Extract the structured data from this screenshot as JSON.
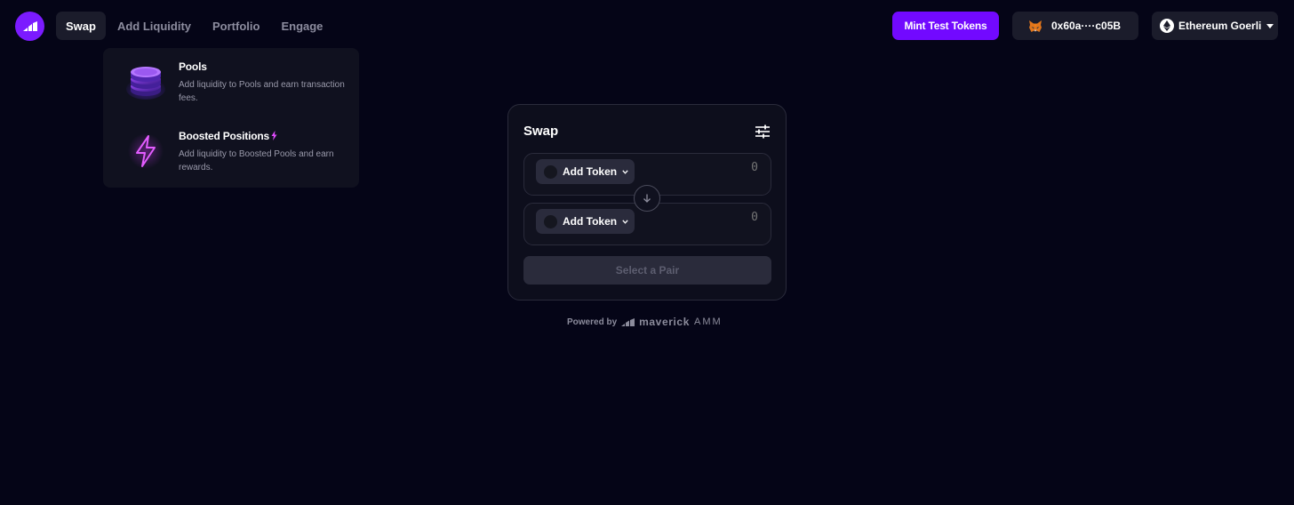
{
  "nav": {
    "items": [
      {
        "label": "Swap",
        "active": true
      },
      {
        "label": "Add Liquidity",
        "active": false
      },
      {
        "label": "Portfolio",
        "active": false
      },
      {
        "label": "Engage",
        "active": false
      }
    ]
  },
  "header": {
    "mint_label": "Mint Test Tokens",
    "wallet_address": "0x60a····c05B",
    "network_label": "Ethereum Goerli"
  },
  "dropdown": {
    "items": [
      {
        "title": "Pools",
        "description": "Add liquidity to Pools and earn transaction fees.",
        "icon": "pools-stack-icon"
      },
      {
        "title": "Boosted Positions",
        "description": "Add liquidity to Boosted Pools and earn rewards.",
        "icon": "lightning-bolt-icon"
      }
    ]
  },
  "swap": {
    "title": "Swap",
    "from": {
      "token_label": "Add Token",
      "amount": "0"
    },
    "to": {
      "token_label": "Add Token",
      "amount": "0"
    },
    "action_label": "Select a Pair"
  },
  "footer": {
    "powered_by": "Powered by",
    "brand": "maverick",
    "suffix": "AMM"
  },
  "colors": {
    "background": "#050517",
    "accent": "#7209ff",
    "surface": "#1b1c2b",
    "card": "#0d0e1c"
  }
}
